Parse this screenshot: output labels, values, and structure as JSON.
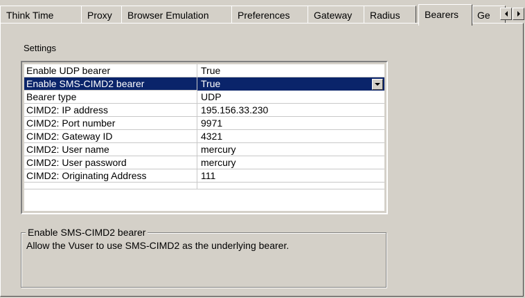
{
  "tabs": [
    {
      "label": "Think Time",
      "active": false
    },
    {
      "label": "Proxy",
      "active": false
    },
    {
      "label": "Browser Emulation",
      "active": false
    },
    {
      "label": "Preferences",
      "active": false
    },
    {
      "label": "Gateway",
      "active": false
    },
    {
      "label": "Radius",
      "active": false
    },
    {
      "label": "Bearers",
      "active": true
    },
    {
      "label": "Ge",
      "active": false
    }
  ],
  "tab_scroll": {
    "left_icon": "arrow-left-icon",
    "right_icon": "arrow-right-icon"
  },
  "settings": {
    "label": "Settings",
    "rows": [
      {
        "name": "Enable UDP bearer",
        "value": "True"
      },
      {
        "name": "Enable SMS-CIMD2 bearer",
        "value": "True"
      },
      {
        "name": "Bearer type",
        "value": "UDP"
      },
      {
        "name": "CIMD2: IP address",
        "value": "195.156.33.230"
      },
      {
        "name": "CIMD2: Port number",
        "value": "9971"
      },
      {
        "name": "CIMD2: Gateway ID",
        "value": "4321"
      },
      {
        "name": "CIMD2: User name",
        "value": "mercury"
      },
      {
        "name": "CIMD2: User password",
        "value": "mercury"
      },
      {
        "name": "CIMD2: Originating Address",
        "value": "111"
      }
    ],
    "selected_row": 1,
    "selection_color": "#0a246a"
  },
  "description": {
    "title": "Enable SMS-CIMD2 bearer",
    "text": "Allow the Vuser to use SMS-CIMD2 as the underlying bearer."
  }
}
